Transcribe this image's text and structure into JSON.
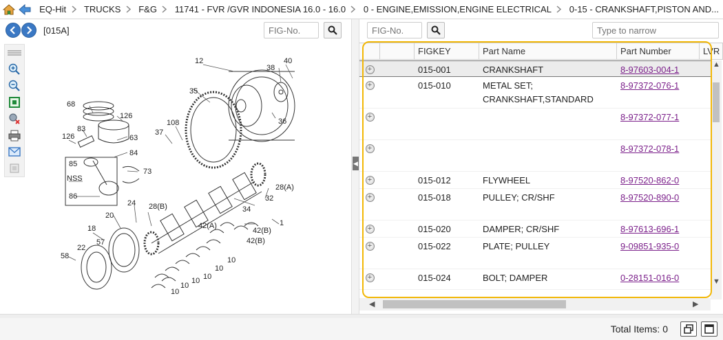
{
  "breadcrumb": [
    "EQ-Hit",
    "TRUCKS",
    "F&G",
    "11741 - FVR /GVR INDONESIA 16.0 - 16.0",
    "0 - ENGINE,EMISSION,ENGINE ELECTRICAL",
    "0-15 - CRANKSHAFT,PISTON AND..."
  ],
  "left": {
    "title_code": "[015A]",
    "fig_placeholder": "FIG-No."
  },
  "right": {
    "fig_placeholder": "FIG-No.",
    "narrow_placeholder": "Type to narrow"
  },
  "grid": {
    "columns": [
      "FIGKEY",
      "Part Name",
      "Part Number",
      "LVR"
    ],
    "rows": [
      {
        "figkey": "015-001",
        "name": "CRANKSHAFT",
        "number": "8-97603-004-1"
      },
      {
        "figkey": "015-010",
        "name": "METAL SET; CRANKSHAFT,STANDARD",
        "number": "8-97372-076-1"
      },
      {
        "figkey": "",
        "name": "",
        "number": "8-97372-077-1"
      },
      {
        "figkey": "",
        "name": "",
        "number": "8-97372-078-1"
      },
      {
        "figkey": "015-012",
        "name": "FLYWHEEL",
        "number": "8-97520-862-0"
      },
      {
        "figkey": "015-018",
        "name": "PULLEY; CR/SHF",
        "number": "8-97520-890-0"
      },
      {
        "figkey": "015-020",
        "name": "DAMPER; CR/SHF",
        "number": "8-97613-696-1"
      },
      {
        "figkey": "015-022",
        "name": "PLATE; PULLEY",
        "number": "9-09851-935-0"
      },
      {
        "figkey": "015-024",
        "name": "BOLT; DAMPER",
        "number": "0-28151-016-0"
      }
    ]
  },
  "diagram": {
    "labels": [
      "12",
      "40",
      "38",
      "35",
      "68",
      "126",
      "108",
      "36",
      "37",
      "83",
      "63",
      "126",
      "84",
      "85",
      "73",
      "NSS",
      "28(A)",
      "86",
      "24",
      "32",
      "34",
      "28(B)",
      "20",
      "1",
      "18",
      "42(A)",
      "42(B)",
      "57",
      "22",
      "42(B)",
      "58",
      "10",
      "10",
      "10",
      "10",
      "10",
      "10"
    ]
  },
  "status": {
    "total_items": "Total Items: 0"
  },
  "colors": {
    "highlight": "#f2b705",
    "link": "#7b1f8a",
    "nav_blue": "#3a78c4"
  }
}
